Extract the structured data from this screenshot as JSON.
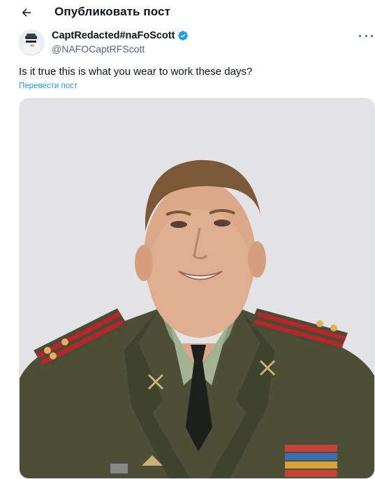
{
  "header": {
    "title": "Опубликовать пост",
    "back_icon": "arrow-left-icon"
  },
  "post": {
    "author": {
      "name": "CaptRedacted#naFoScott",
      "handle": "@NAFOCaptRFScott",
      "verified": true,
      "verified_color": "#1d9bf0"
    },
    "text": "Is it true this is what you wear to work these days?",
    "translate_label": "Перевести пост",
    "more_icon": "more-horizontal-icon"
  },
  "colors": {
    "accent": "#1d9bf0",
    "secondary_text": "#536471",
    "primary_text": "#0f1419"
  }
}
